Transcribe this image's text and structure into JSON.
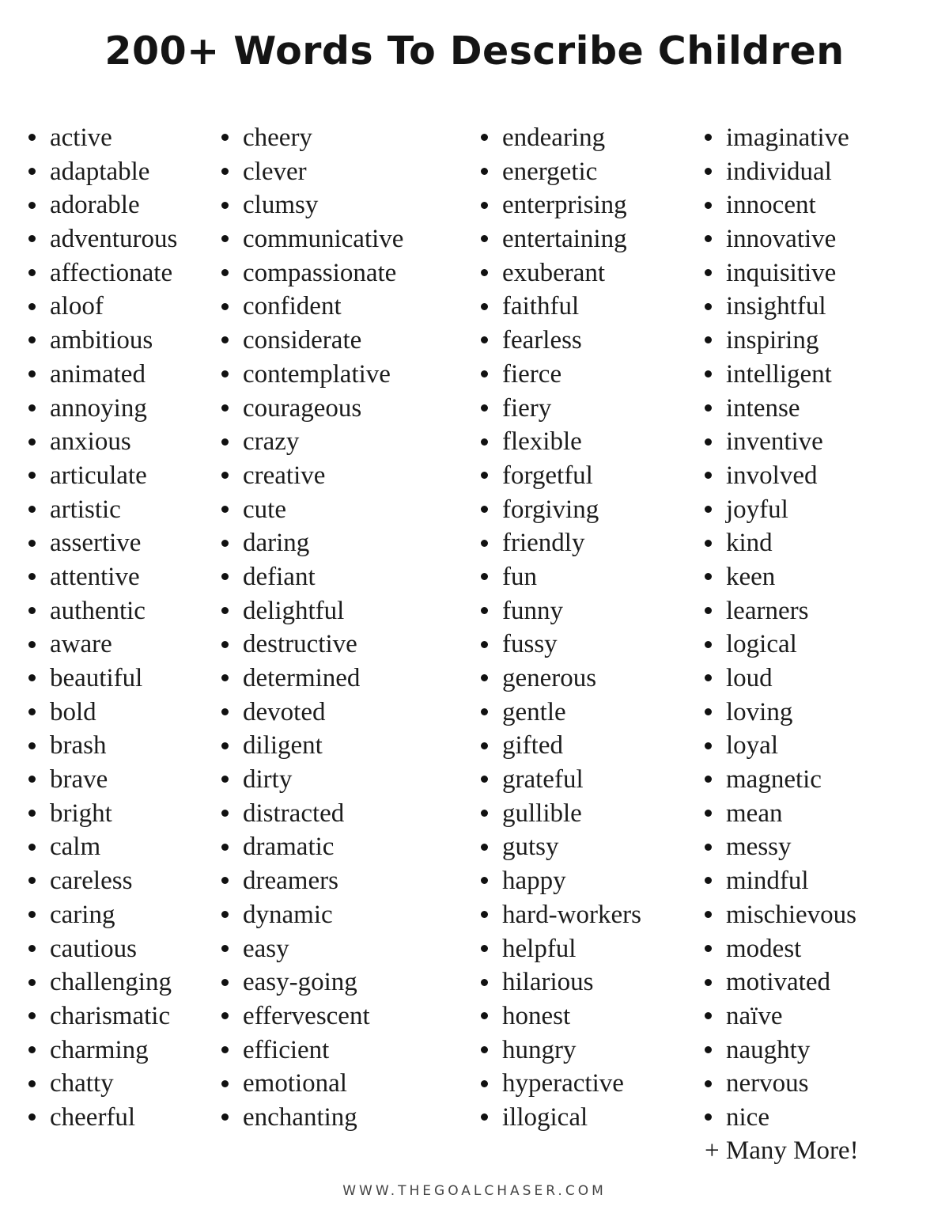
{
  "title": "200+ Words To Describe Children",
  "columns": [
    [
      "active",
      "adaptable",
      "adorable",
      "adventurous",
      "affectionate",
      "aloof",
      "ambitious",
      "animated",
      "annoying",
      "anxious",
      "articulate",
      "artistic",
      "assertive",
      "attentive",
      "authentic",
      "aware",
      "beautiful",
      "bold",
      "brash",
      "brave",
      "bright",
      "calm",
      "careless",
      "caring",
      "cautious",
      "challenging",
      "charismatic",
      "charming",
      "chatty",
      "cheerful"
    ],
    [
      "cheery",
      "clever",
      "clumsy",
      "communicative",
      "compassionate",
      "confident",
      "considerate",
      "contemplative",
      "courageous",
      "crazy",
      "creative",
      "cute",
      "daring",
      "defiant",
      "delightful",
      "destructive",
      "determined",
      "devoted",
      "diligent",
      "dirty",
      "distracted",
      "dramatic",
      "dreamers",
      "dynamic",
      "easy",
      "easy-going",
      "effervescent",
      "efficient",
      "emotional",
      "enchanting"
    ],
    [
      "endearing",
      "energetic",
      "enterprising",
      "entertaining",
      "exuberant",
      "faithful",
      "fearless",
      "fierce",
      "fiery",
      "flexible",
      "forgetful",
      "forgiving",
      "friendly",
      "fun",
      "funny",
      "fussy",
      "generous",
      "gentle",
      "gifted",
      "grateful",
      "gullible",
      "gutsy",
      "happy",
      "hard-workers",
      "helpful",
      "hilarious",
      "honest",
      "hungry",
      "hyperactive",
      "illogical"
    ],
    [
      "imaginative",
      "individual",
      "innocent",
      "innovative",
      "inquisitive",
      "insightful",
      "inspiring",
      "intelligent",
      "intense",
      "inventive",
      "involved",
      "joyful",
      "kind",
      "keen",
      "learners",
      "logical",
      "loud",
      "loving",
      "loyal",
      "magnetic",
      "mean",
      "messy",
      "mindful",
      "mischievous",
      "modest",
      "motivated",
      "naïve",
      "naughty",
      "nervous",
      "nice"
    ]
  ],
  "more_label": "+ Many More!",
  "footer": "WWW.THEGOALCHASER.COM"
}
